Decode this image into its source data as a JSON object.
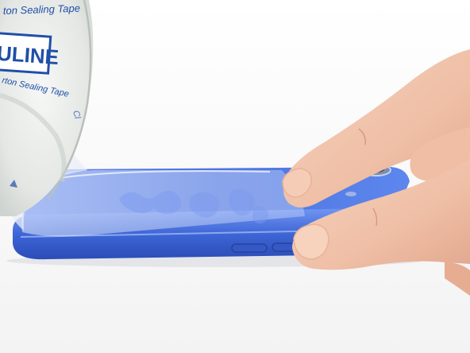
{
  "photo": {
    "tape_roll": {
      "brand": "ULINE",
      "print_line_1": "ton Sealing Tape",
      "print_line_2": "rton Sealing Tape",
      "print_line_3": "Cl"
    },
    "colors": {
      "background": "#ffffff",
      "phone_blue": "#4a73e0",
      "phone_edge": "#2f55c4",
      "tape_print": "#1f4fa8",
      "skin": "#f1c4ae"
    }
  }
}
